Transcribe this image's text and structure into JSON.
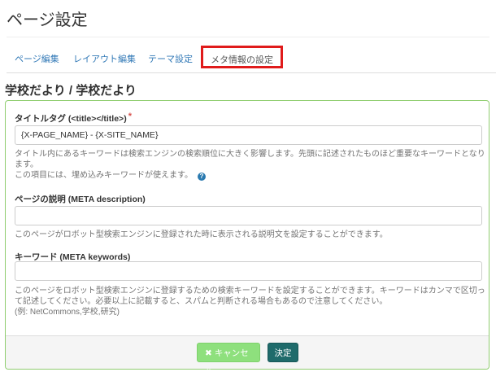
{
  "page": {
    "title": "ページ設定"
  },
  "tabs": [
    {
      "label": "ページ編集"
    },
    {
      "label": "レイアウト編集"
    },
    {
      "label": "テーマ設定"
    },
    {
      "label": "メタ情報の設定"
    }
  ],
  "block": {
    "title": "学校だより / 学校だより"
  },
  "form": {
    "title_tag": {
      "label": "タイトルタグ (<title></title>)",
      "required_mark": "*",
      "value": "{X-PAGE_NAME} - {X-SITE_NAME}",
      "help_line1": "タイトル内にあるキーワードは検索エンジンの検索順位に大きく影響します。先頭に記述されたものほど重要なキーワードとなり",
      "help_line2": "ます。",
      "help_line3": "この項目には、埋め込みキーワードが使えます。",
      "help_icon": "?"
    },
    "description": {
      "label": "ページの説明 (META description)",
      "value": "",
      "help": "このページがロボット型検索エンジンに登録された時に表示される説明文を設定することができます。"
    },
    "keywords": {
      "label": "キーワード (META keywords)",
      "value": "",
      "help_line1": "このページをロボット型検索エンジンに登録するための検索キーワードを設定することができます。キーワードはカンマで区切っ",
      "help_line2": "て記述してください。必要以上に記載すると、スパムと判断される場合もあるので注意してください。",
      "help_line3": "(例: NetCommons,学校,研究)"
    }
  },
  "footer": {
    "cancel_label": "キャンセル",
    "cancel_icon": "✖",
    "decide_label": "決定"
  },
  "colors": {
    "active_tab_border": "#e01b1b",
    "panel_border": "#8fcd6f",
    "cancel_button": "#8ee07d",
    "decide_button": "#1f6b6b",
    "link": "#337ab7"
  }
}
